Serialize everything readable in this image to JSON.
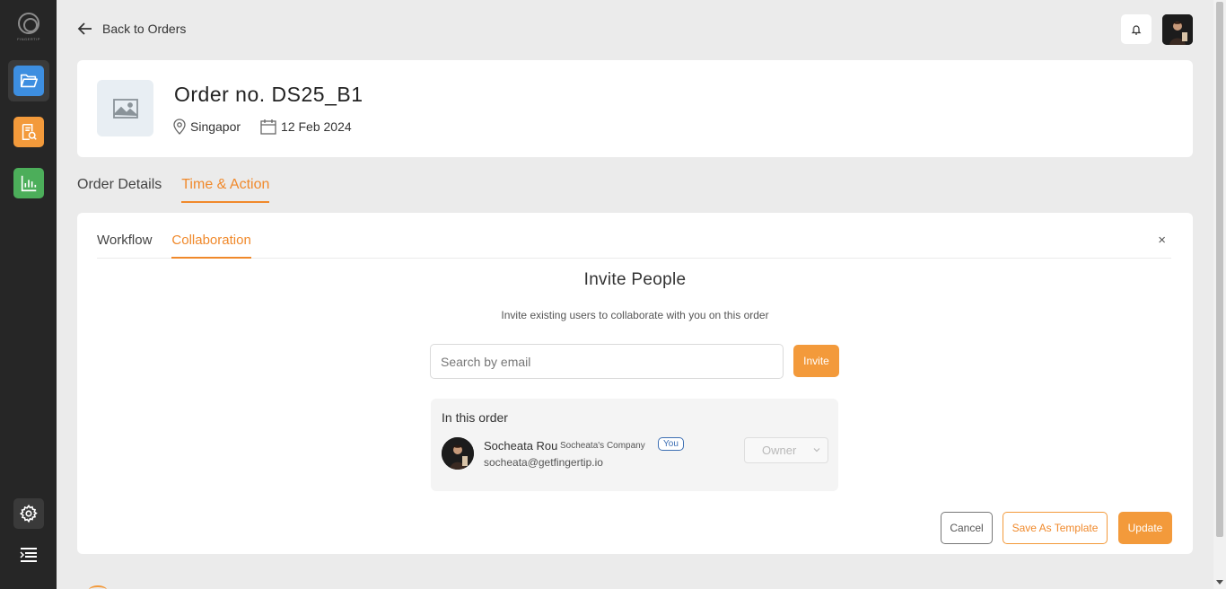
{
  "sidebar": {
    "logo_text": "FINGERTIP",
    "items": [
      {
        "name": "orders",
        "icon": "folder-open-icon",
        "color": "#3d8ee0",
        "active": true
      },
      {
        "name": "reports",
        "icon": "report-search-icon",
        "color": "#f39a3b",
        "active": false
      },
      {
        "name": "analytics",
        "icon": "bar-chart-icon",
        "color": "#4cae5a",
        "active": false
      },
      {
        "name": "settings",
        "icon": "gear-icon",
        "active": false
      },
      {
        "name": "menu",
        "icon": "menu-collapse-icon",
        "active": false
      }
    ]
  },
  "header": {
    "back_label": "Back to Orders",
    "notification_icon": "bell-icon"
  },
  "order": {
    "title": "Order no. DS25_B1",
    "location": "Singapor",
    "date": "12 Feb 2024"
  },
  "main_tabs": [
    {
      "label": "Order Details",
      "active": false
    },
    {
      "label": "Time & Action",
      "active": true
    }
  ],
  "sub_tabs": [
    {
      "label": "Workflow",
      "active": false
    },
    {
      "label": "Collaboration",
      "active": true
    }
  ],
  "invite": {
    "title": "Invite People",
    "subtitle": "Invite existing users to collaborate with you on this order",
    "search_placeholder": "Search by email",
    "invite_button": "Invite"
  },
  "members_section": {
    "title": "In this order",
    "members": [
      {
        "name": "Socheata Rou",
        "company": "Socheata's Company",
        "badge": "You",
        "email": "socheata@getfingertip.io",
        "role": "Owner"
      }
    ]
  },
  "actions": {
    "cancel": "Cancel",
    "save_template": "Save As Template",
    "update": "Update"
  },
  "colors": {
    "accent": "#f39a3b",
    "accent_text": "#f0892b",
    "badge": "#3d6fb3",
    "sidebar_bg": "#262626"
  }
}
